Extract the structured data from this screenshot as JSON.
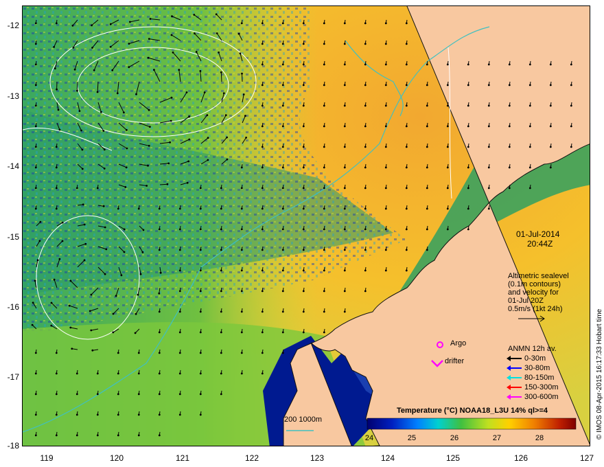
{
  "map": {
    "y_ticks": [
      "-12",
      "-13",
      "-14",
      "-15",
      "-16",
      "-17",
      "-18"
    ],
    "x_ticks": [
      "119",
      "120",
      "121",
      "122",
      "123",
      "124",
      "125",
      "126",
      "127"
    ],
    "colors": {
      "land": "#f8c8a0",
      "cool": "#1a3fb0",
      "mid": "#50b848",
      "warm": "#f2a830",
      "contour": "#ffffff",
      "bathymetry": "#40c0c0"
    }
  },
  "date_label": {
    "date": "01-Jul-2014",
    "time": "20:44Z"
  },
  "altimetry_note": {
    "line1": "Altimetric sealevel",
    "line2": "(0.1m contours)",
    "line3": "and velocity for",
    "line4": "01-Jul 20Z",
    "line5": "0.5m/s (1kt 24h)"
  },
  "markers": {
    "argo": "Argo",
    "drifter": "drifter",
    "argo_color": "#ff00ff",
    "drifter_color": "#ff00ff"
  },
  "anmn_legend": {
    "title": "ANMN 12h av.",
    "items": [
      {
        "label": "0-30m",
        "color": "#000000"
      },
      {
        "label": "30-80m",
        "color": "#0000ff"
      },
      {
        "label": "80-150m",
        "color": "#00e0e0"
      },
      {
        "label": "150-300m",
        "color": "#ff0000"
      },
      {
        "label": "300-600m",
        "color": "#ff00ff"
      }
    ]
  },
  "bathy_legend": {
    "label": "200  1000m"
  },
  "colorbar": {
    "title": "Temperature (°C) NOAA18_L3U 14% ql>=4",
    "ticks": [
      "24",
      "25",
      "26",
      "27",
      "28"
    ],
    "range": [
      23.7,
      28.8
    ],
    "stops": [
      "#000070",
      "#0020c0",
      "#0080ff",
      "#00d0d0",
      "#40c040",
      "#c0e020",
      "#ffd000",
      "#f08000",
      "#c02000",
      "#800000"
    ]
  },
  "credit": "© IMOS 08-Apr-2015 16:17:33 Hobart time"
}
